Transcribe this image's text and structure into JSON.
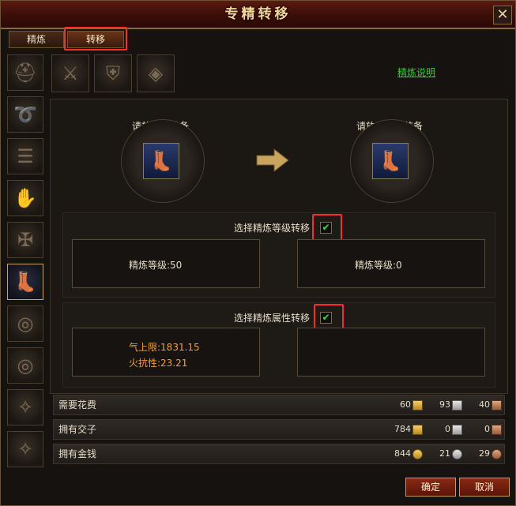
{
  "window": {
    "title": "专精转移",
    "close_symbol": "✕"
  },
  "tabs": [
    {
      "label": "精炼",
      "active": false
    },
    {
      "label": "转移",
      "active": true
    }
  ],
  "sidebar": {
    "items": [
      {
        "icon": "helmet-icon",
        "glyph": "⛑",
        "active": false
      },
      {
        "icon": "belt-icon",
        "glyph": "➰",
        "active": false
      },
      {
        "icon": "bracer-icon",
        "glyph": "☰",
        "active": false
      },
      {
        "icon": "gloves-icon",
        "glyph": "✋",
        "active": false
      },
      {
        "icon": "shoulder-icon",
        "glyph": "✠",
        "active": false
      },
      {
        "icon": "boots-icon",
        "glyph": "👢",
        "active": true
      },
      {
        "icon": "ring-icon",
        "glyph": "◎",
        "active": false
      },
      {
        "icon": "ring-icon",
        "glyph": "◎",
        "active": false
      },
      {
        "icon": "talisman-icon",
        "glyph": "✧",
        "active": false
      },
      {
        "icon": "talisman-icon",
        "glyph": "✧",
        "active": false
      }
    ]
  },
  "topbar": {
    "items": [
      {
        "icon": "weapon-icon",
        "glyph": "⚔"
      },
      {
        "icon": "armor-icon",
        "glyph": "⛨"
      },
      {
        "icon": "necklace-icon",
        "glyph": "◈"
      }
    ]
  },
  "help_link": "精炼说明",
  "source": {
    "label": "请放入源装备",
    "item_icon": "boots-icon",
    "glyph": "👢"
  },
  "target": {
    "label": "请放入目标装备",
    "item_icon": "boots-icon",
    "glyph": "👢"
  },
  "level_section": {
    "label": "选择精炼等级转移",
    "checked": true,
    "check_glyph": "✔",
    "source_text": "精炼等级:50",
    "target_text": "精炼等级:0"
  },
  "attr_section": {
    "label": "选择精炼属性转移",
    "checked": true,
    "check_glyph": "✔",
    "source_attrs": [
      "气上限:1831.15",
      "火抗性:23.21"
    ],
    "target_attrs": []
  },
  "costs": [
    {
      "label": "需要花费",
      "values": [
        "60",
        "93",
        "40"
      ],
      "kind": "ingot"
    },
    {
      "label": "拥有交子",
      "values": [
        "784",
        "0",
        "0"
      ],
      "kind": "ingot"
    },
    {
      "label": "拥有金钱",
      "values": [
        "844",
        "21",
        "29"
      ],
      "kind": "coin"
    }
  ],
  "buttons": {
    "confirm": "确定",
    "cancel": "取消"
  },
  "colors": {
    "accent": "#ff2a2a",
    "link": "#2cd22c",
    "attr": "#f0a040"
  }
}
